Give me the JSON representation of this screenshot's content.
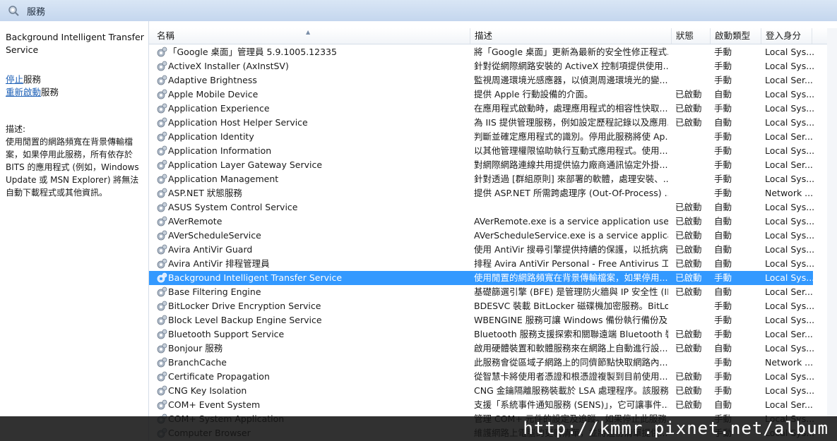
{
  "window": {
    "title": "服務"
  },
  "left_pane": {
    "service_name": "Background Intelligent Transfer Service",
    "actions": [
      {
        "link": "停止",
        "suffix": "服務"
      },
      {
        "link": "重新啟動",
        "suffix": "服務"
      }
    ],
    "description_label": "描述:",
    "description_text": "使用閒置的網路頻寬在背景傳輸檔案，如果停用此服務，所有依存於 BITS 的應用程式 (例如，Windows Update 或 MSN Explorer) 將無法自動下載程式或其他資訊。"
  },
  "columns": {
    "name": "名稱",
    "description": "描述",
    "status": "狀態",
    "startup": "啟動類型",
    "logon": "登入身分"
  },
  "rows": [
    {
      "name": "「Google 桌面」管理員 5.9.1005.12335",
      "description": "將「Google 桌面」更新為最新的安全性修正程式...",
      "status": "",
      "startup": "手動",
      "logon": "Local Sys..."
    },
    {
      "name": "ActiveX Installer (AxInstSV)",
      "description": "針對從網際網路安裝的 ActiveX 控制項提供使用...",
      "status": "",
      "startup": "手動",
      "logon": "Local Sys..."
    },
    {
      "name": "Adaptive Brightness",
      "description": "監視周邊環境光感應器，以偵測周邊環境光的變...",
      "status": "",
      "startup": "手動",
      "logon": "Local Ser..."
    },
    {
      "name": "Apple Mobile Device",
      "description": "提供 Apple 行動設備的介面。",
      "status": "已啟動",
      "startup": "自動",
      "logon": "Local Sys..."
    },
    {
      "name": "Application Experience",
      "description": "在應用程式啟動時，處理應用程式的相容性快取...",
      "status": "已啟動",
      "startup": "手動",
      "logon": "Local Sys..."
    },
    {
      "name": "Application Host Helper Service",
      "description": "為 IIS 提供管理服務，例如設定歷程記錄以及應用...",
      "status": "已啟動",
      "startup": "自動",
      "logon": "Local Sys..."
    },
    {
      "name": "Application Identity",
      "description": "判斷並確定應用程式的識別。停用此服務將使 Ap...",
      "status": "",
      "startup": "手動",
      "logon": "Local Ser..."
    },
    {
      "name": "Application Information",
      "description": "以其他管理權限協助執行互動式應用程式。使用...",
      "status": "",
      "startup": "手動",
      "logon": "Local Sys..."
    },
    {
      "name": "Application Layer Gateway Service",
      "description": "對網際網路連線共用提供協力廠商通訊協定外掛...",
      "status": "",
      "startup": "手動",
      "logon": "Local Ser..."
    },
    {
      "name": "Application Management",
      "description": "針對透過 [群組原則] 來部署的軟體，處理安裝、...",
      "status": "",
      "startup": "手動",
      "logon": "Local Sys..."
    },
    {
      "name": "ASP.NET 狀態服務",
      "description": "提供 ASP.NET 所需跨處理序 (Out-Of-Process) ...",
      "status": "",
      "startup": "手動",
      "logon": "Network ..."
    },
    {
      "name": "ASUS System Control Service",
      "description": "",
      "status": "已啟動",
      "startup": "自動",
      "logon": "Local Sys..."
    },
    {
      "name": "AVerRemote",
      "description": "AVerRemote.exe is a service application used t...",
      "status": "已啟動",
      "startup": "自動",
      "logon": "Local Sys..."
    },
    {
      "name": "AVerScheduleService",
      "description": "AVerScheduleService.exe is a service applicati...",
      "status": "已啟動",
      "startup": "自動",
      "logon": "Local Sys..."
    },
    {
      "name": "Avira AntiVir Guard",
      "description": "使用 AntiVir 搜尋引擎提供持續的保護，以抵抗病...",
      "status": "已啟動",
      "startup": "自動",
      "logon": "Local Sys..."
    },
    {
      "name": "Avira AntiVir 排程管理員",
      "description": "排程 Avira AntiVir Personal - Free Antivirus 工作...",
      "status": "已啟動",
      "startup": "自動",
      "logon": "Local Sys..."
    },
    {
      "name": "Background Intelligent Transfer Service",
      "description": "使用閒置的網路頻寬在背景傳輸檔案，如果停用...",
      "status": "已啟動",
      "startup": "手動",
      "logon": "Local Sys...",
      "selected": true
    },
    {
      "name": "Base Filtering Engine",
      "description": "基礎篩選引擎 (BFE) 是管理防火牆與 IP 安全性 (IP...",
      "status": "已啟動",
      "startup": "自動",
      "logon": "Local Ser..."
    },
    {
      "name": "BitLocker Drive Encryption Service",
      "description": "BDESVC 裝載 BitLocker 磁碟機加密服務。BitLoc...",
      "status": "",
      "startup": "手動",
      "logon": "Local Sys..."
    },
    {
      "name": "Block Level Backup Engine Service",
      "description": "WBENGINE 服務可讓 Windows 備份執行備份及...",
      "status": "",
      "startup": "手動",
      "logon": "Local Sys..."
    },
    {
      "name": "Bluetooth Support Service",
      "description": "Bluetooth 服務支援探索和關聯遠端 Bluetooth 裝...",
      "status": "已啟動",
      "startup": "手動",
      "logon": "Local Ser..."
    },
    {
      "name": "Bonjour 服務",
      "description": "啟用硬體裝置和軟體服務來在網路上自動進行設...",
      "status": "已啟動",
      "startup": "自動",
      "logon": "Local Sys..."
    },
    {
      "name": "BranchCache",
      "description": "此服務會從區域子網路上的同儕節點快取網路內...",
      "status": "",
      "startup": "手動",
      "logon": "Network ..."
    },
    {
      "name": "Certificate Propagation",
      "description": "從智慧卡將使用者憑證和根憑證複製到目前使用...",
      "status": "已啟動",
      "startup": "手動",
      "logon": "Local Sys..."
    },
    {
      "name": "CNG Key Isolation",
      "description": "CNG 金鑰隔離服務裝載於 LSA 處理程序。該服務...",
      "status": "已啟動",
      "startup": "手動",
      "logon": "Local Sys..."
    },
    {
      "name": "COM+ Event System",
      "description": "支援「系統事件通知服務 (SENS)」，它可讓事件...",
      "status": "已啟動",
      "startup": "自動",
      "logon": "Local Ser..."
    },
    {
      "name": "COM+ System Application",
      "description": "管理 COM+ 元件的設定及追蹤。如果停止此服務...",
      "status": "",
      "startup": "手動",
      "logon": "Local Sys..."
    },
    {
      "name": "Computer Browser",
      "description": "維護網路上電腦的更新清單，並將這份清單提供...",
      "status": "",
      "startup": "手動",
      "logon": "Local Sys..."
    }
  ],
  "watermark": "http://kmmr.pixnet.net/album",
  "icons": {
    "title": "gear-search-icon",
    "row": "service-gear-icon"
  }
}
